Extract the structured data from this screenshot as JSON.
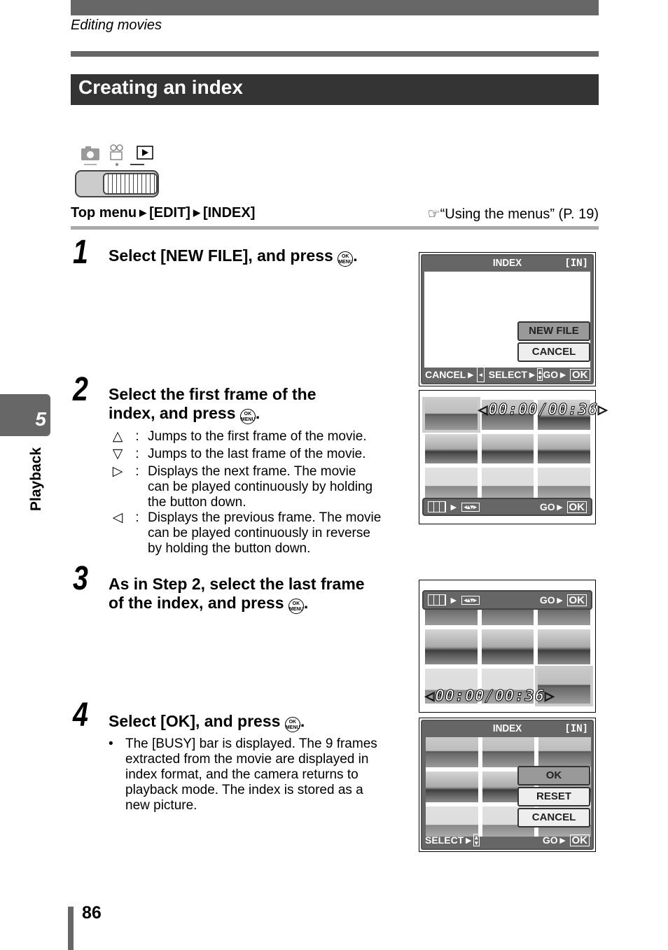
{
  "header": {
    "running_head": "Editing movies",
    "section_title": "Creating an index"
  },
  "mode_icons": [
    "camera-icon",
    "movie-icon",
    "playback-icon"
  ],
  "menu_path": {
    "items": [
      "Top menu",
      "[EDIT]",
      "[INDEX]"
    ],
    "separator": "▶"
  },
  "reference": {
    "icon": "hand-pointer-icon",
    "text": "“Using the menus” (P. 19)"
  },
  "ok_menu_button": {
    "top": "OK",
    "bottom": "MENU"
  },
  "steps": [
    {
      "number": "1",
      "heading": "Select [NEW FILE], and press"
    },
    {
      "number": "2",
      "heading_line1": "Select the first frame of the",
      "heading_line2": "index, and press",
      "items": [
        {
          "symbol": "△",
          "text": "Jumps to the first frame of the movie."
        },
        {
          "symbol": "▽",
          "text": "Jumps to the last frame of the movie."
        },
        {
          "symbol": "▷",
          "text": "Displays the next frame. The movie can be played continuously by holding the button down."
        },
        {
          "symbol": "◁",
          "text": "Displays the previous frame. The movie can be played continuously in reverse by holding the button down."
        }
      ]
    },
    {
      "number": "3",
      "heading_line1": "As in Step 2, select the last frame",
      "heading_line2": "of the index, and press"
    },
    {
      "number": "4",
      "heading": "Select [OK], and press",
      "bullet": "The [BUSY] bar is displayed. The 9 frames extracted from the movie are displayed in index format, and the camera returns to playback mode. The index is stored as a new picture."
    }
  ],
  "screens": {
    "s1": {
      "title": "INDEX",
      "memory": "[IN]",
      "options": [
        "NEW FILE",
        "CANCEL"
      ],
      "selected": 0,
      "footer": {
        "cancel": "CANCEL",
        "select": "SELECT",
        "go": "GO",
        "ok": "OK"
      }
    },
    "s2": {
      "timecode": "00:00/00:36",
      "go": "GO",
      "ok": "OK"
    },
    "s3": {
      "timecode": "00:00/00:36",
      "go": "GO",
      "ok": "OK"
    },
    "s4": {
      "title": "INDEX",
      "memory": "[IN]",
      "options": [
        "OK",
        "RESET",
        "CANCEL"
      ],
      "selected": 0,
      "footer": {
        "select": "SELECT",
        "go": "GO",
        "ok": "OK"
      }
    }
  },
  "side_tab": {
    "chapter": "5",
    "label": "Playback"
  },
  "page_number": "86"
}
